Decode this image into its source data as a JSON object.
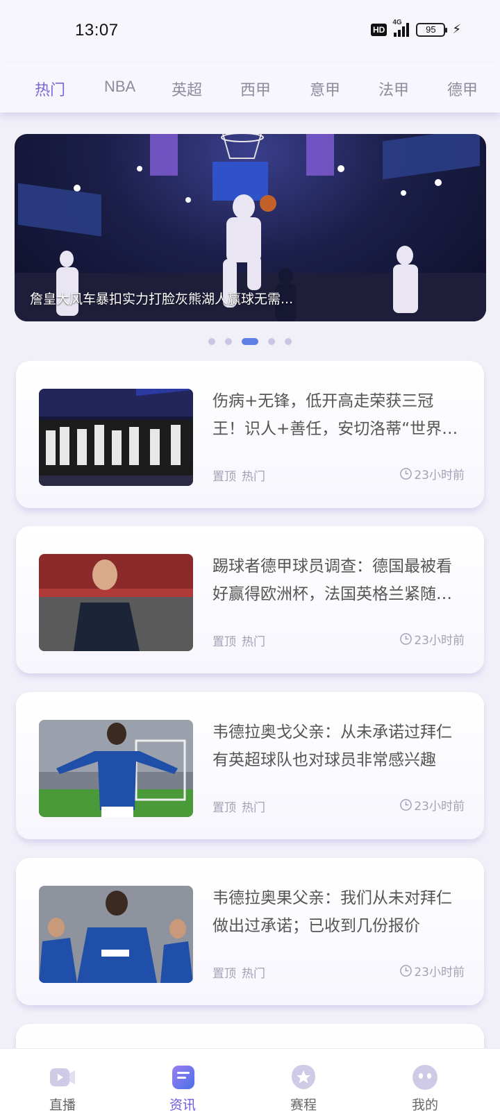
{
  "status_bar": {
    "time": "13:07",
    "hd": "HD",
    "network": "4G",
    "battery": "95"
  },
  "tabs": [
    {
      "label": "热门",
      "active": true
    },
    {
      "label": "NBA",
      "active": false
    },
    {
      "label": "英超",
      "active": false
    },
    {
      "label": "西甲",
      "active": false
    },
    {
      "label": "意甲",
      "active": false
    },
    {
      "label": "法甲",
      "active": false
    },
    {
      "label": "德甲",
      "active": false
    }
  ],
  "banner": {
    "caption": "詹皇大风车暴扣实力打脸灰熊湖人赢球无需...",
    "dots": 5,
    "active_dot": 3
  },
  "news": [
    {
      "title": "伤病+无锋，低开高走荣获三冠王！识人+善任，安切洛蒂“世界第一教练”成色十足",
      "tags": [
        "置顶",
        "热门"
      ],
      "time": "23小时前"
    },
    {
      "title": "踢球者德甲球员调查：德国最被看好赢得欧洲杯，法国英格兰紧随其后",
      "tags": [
        "置顶",
        "热门"
      ],
      "time": "23小时前"
    },
    {
      "title": "韦德拉奥戈父亲：从未承诺过拜仁 有英超球队也对球员非常感兴趣",
      "tags": [
        "置顶",
        "热门"
      ],
      "time": "23小时前"
    },
    {
      "title": "韦德拉奥果父亲：我们从未对拜仁做出过承诺；已收到几份报价",
      "tags": [
        "置顶",
        "热门"
      ],
      "time": "23小时前"
    }
  ],
  "bottom_nav": [
    {
      "label": "直播",
      "icon": "video-icon",
      "active": false
    },
    {
      "label": "资讯",
      "icon": "news-icon",
      "active": true
    },
    {
      "label": "赛程",
      "icon": "star-icon",
      "active": false
    },
    {
      "label": "我的",
      "icon": "profile-icon",
      "active": false
    }
  ],
  "colors": {
    "accent": "#7a64d8",
    "active_dot": "#5f7fe6",
    "background": "#f1f0f8"
  }
}
